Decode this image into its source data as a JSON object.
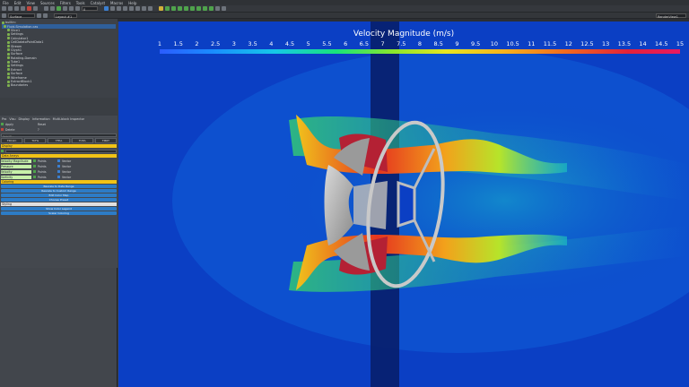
{
  "menu": [
    "File",
    "Edit",
    "View",
    "Sources",
    "Filters",
    "Tools",
    "Catalyst",
    "Macros",
    "Help"
  ],
  "toolbar": {
    "time_value": "0",
    "representation": "Surface",
    "layout_label": "Layout #1",
    "render_view_label": "RenderView1"
  },
  "pipeline": {
    "items": [
      "builtin:",
      "Fluid-Simulation.cas",
      "Slice1",
      "Settings",
      "Calculator1",
      "CellDatatoPointData1",
      "Stream",
      "Glyph1",
      "Surface",
      "Rotating-Domain",
      "Tube1",
      "Settings",
      "Extract",
      "Surface",
      "Wireframe",
      "ExtractBlock1",
      "Boundaries"
    ],
    "selected_index": 1
  },
  "properties": {
    "tabs": [
      "Pro",
      "Visu",
      "Display",
      "Information",
      "Multi-block Inspector"
    ],
    "search_placeholder": "Search...",
    "rows": [
      {
        "label": "Apply",
        "value": "Reset"
      },
      {
        "label": "Delete",
        "value": "?"
      }
    ],
    "mode_buttons": [
      "TRCLIC",
      "TCFG",
      "TFEA",
      "TCEA",
      "TMRT"
    ],
    "sections": [
      {
        "title": "Display"
      },
      {
        "title": "Data Arrays"
      },
      {
        "title": "Coloring"
      },
      {
        "title": "Styling"
      }
    ],
    "array_rows": [
      {
        "name": "Velocity Magnitude",
        "a": "Points",
        "b": "Vector"
      },
      {
        "name": "Pressure",
        "a": "Points",
        "b": "Vector"
      },
      {
        "name": "Velocity",
        "a": "Points",
        "b": "Vector"
      },
      {
        "name": "Vorticity",
        "a": "Points",
        "b": "Vector"
      }
    ],
    "buttons": [
      "Rescale to Data Range",
      "Rescale to Custom Range",
      "Edit Color Map",
      "Choose Preset",
      "Show Color Legend",
      "Scalar Coloring"
    ]
  },
  "viewport": {
    "background": "#0b3fc4",
    "band_color": "#08206e"
  },
  "legend": {
    "title": "Velocity Magnitude (m/s)",
    "ticks": [
      "1",
      "1.5",
      "2",
      "2.5",
      "3",
      "3.5",
      "4",
      "4.5",
      "5",
      "5.5",
      "6",
      "6.5",
      "7",
      "7.5",
      "8",
      "8.5",
      "9",
      "9.5",
      "10",
      "10.5",
      "11",
      "11.5",
      "12",
      "12.5",
      "13",
      "13.5",
      "14",
      "14.5",
      "15"
    ],
    "colormap": [
      "#2b5cff",
      "#1a8cff",
      "#16c8e8",
      "#19e37a",
      "#8be62b",
      "#e7e520",
      "#f6b41c",
      "#f26a1e",
      "#e3223a",
      "#e81a62"
    ]
  }
}
